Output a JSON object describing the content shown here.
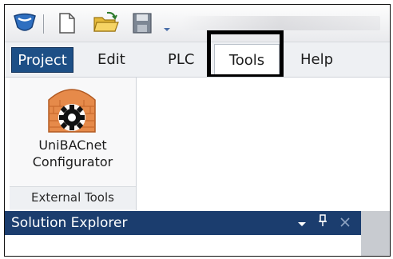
{
  "quick_access": {
    "icons": [
      "app-logo-icon",
      "new-file-icon",
      "open-folder-icon",
      "save-icon",
      "dropdown-arrow-icon"
    ]
  },
  "menu": {
    "tabs": [
      {
        "label": "Project",
        "active_style": "selected-blue"
      },
      {
        "label": "Edit"
      },
      {
        "label": "PLC"
      },
      {
        "label": "Tools",
        "highlighted": true
      },
      {
        "label": "Help"
      }
    ]
  },
  "ribbon": {
    "group_label": "External Tools",
    "tool": {
      "line1": "UniBACnet",
      "line2": "Configurator",
      "icon": "brick-gear-icon"
    }
  },
  "solution_explorer": {
    "title": "Solution Explorer",
    "controls": [
      "dropdown-icon",
      "pin-icon",
      "close-icon"
    ]
  },
  "colors": {
    "project_tab": "#1d4f86",
    "panel_header": "#1b3d6e",
    "highlight": "#000000",
    "brick": "#e07a3a"
  }
}
